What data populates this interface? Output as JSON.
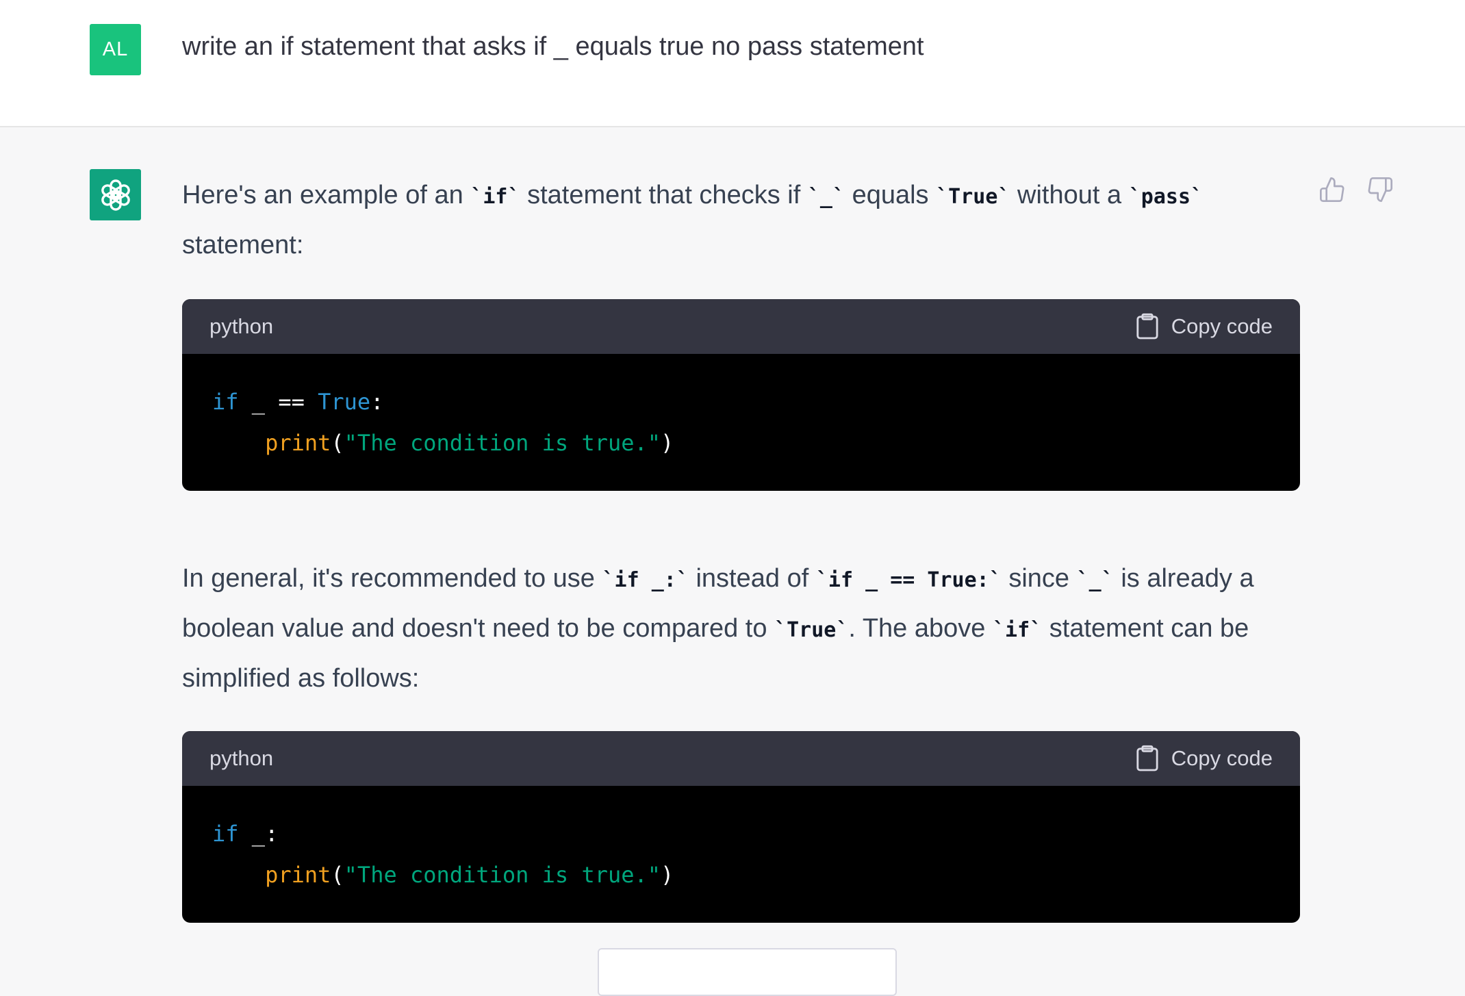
{
  "user": {
    "avatar_initials": "AL",
    "message": "write an if statement that asks if _ equals true no pass statement"
  },
  "assistant": {
    "p1": {
      "t1": "Here's an example of an ",
      "c1": "`if`",
      "t2": " statement that checks if ",
      "c2": "`_`",
      "t3": " equals ",
      "c3": "`True`",
      "t4": " without a ",
      "c4": "`pass`",
      "t5": " statement:"
    },
    "code1": {
      "language": "python",
      "copy_label": "Copy code",
      "line1": {
        "kw": "if",
        "rest": " _ == ",
        "kw2": "True",
        "end": ":"
      },
      "line2": {
        "indent": "    ",
        "fn": "print",
        "open": "(",
        "str": "\"The condition is true.\"",
        "close": ")"
      }
    },
    "p2": {
      "t1": "In general, it's recommended to use ",
      "c1": "`if _:`",
      "t2": " instead of ",
      "c2": "`if _ == True:`",
      "t3": " since ",
      "c3": "`_`",
      "t4": " is already a boolean value and doesn't need to be compared to ",
      "c4": "`True`",
      "t5": ". The above ",
      "c5": "`if`",
      "t6": " statement can be simplified as follows:"
    },
    "code2": {
      "language": "python",
      "copy_label": "Copy code",
      "line1": {
        "kw": "if",
        "rest": " _:"
      },
      "line2": {
        "indent": "    ",
        "fn": "print",
        "open": "(",
        "str": "\"The condition is true.\"",
        "close": ")"
      }
    }
  },
  "icons": [
    "openai-logo-icon",
    "thumbs-up-icon",
    "thumbs-down-icon",
    "clipboard-icon"
  ],
  "colors": {
    "user_avatar": "#19c37d",
    "assistant_avatar": "#10a37f",
    "code_keyword": "#2e95d3",
    "code_function": "#f0a020",
    "code_string": "#00a67d"
  }
}
